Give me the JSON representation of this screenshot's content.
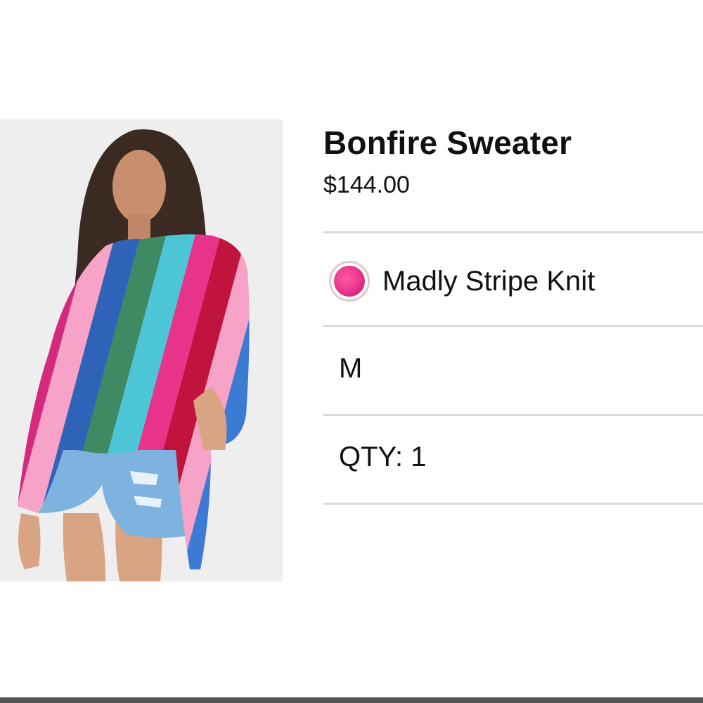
{
  "product": {
    "name": "Bonfire Sweater",
    "price": "$144.00",
    "color": {
      "name": "Madly Stripe Knit",
      "swatch_color": "#e8338a"
    },
    "size": "M",
    "quantity_text": "QTY: 1"
  },
  "colors": {
    "divider": "#dcdad4",
    "swatch_ring": "#e2c9c6",
    "image_background": "#eeeeee"
  }
}
